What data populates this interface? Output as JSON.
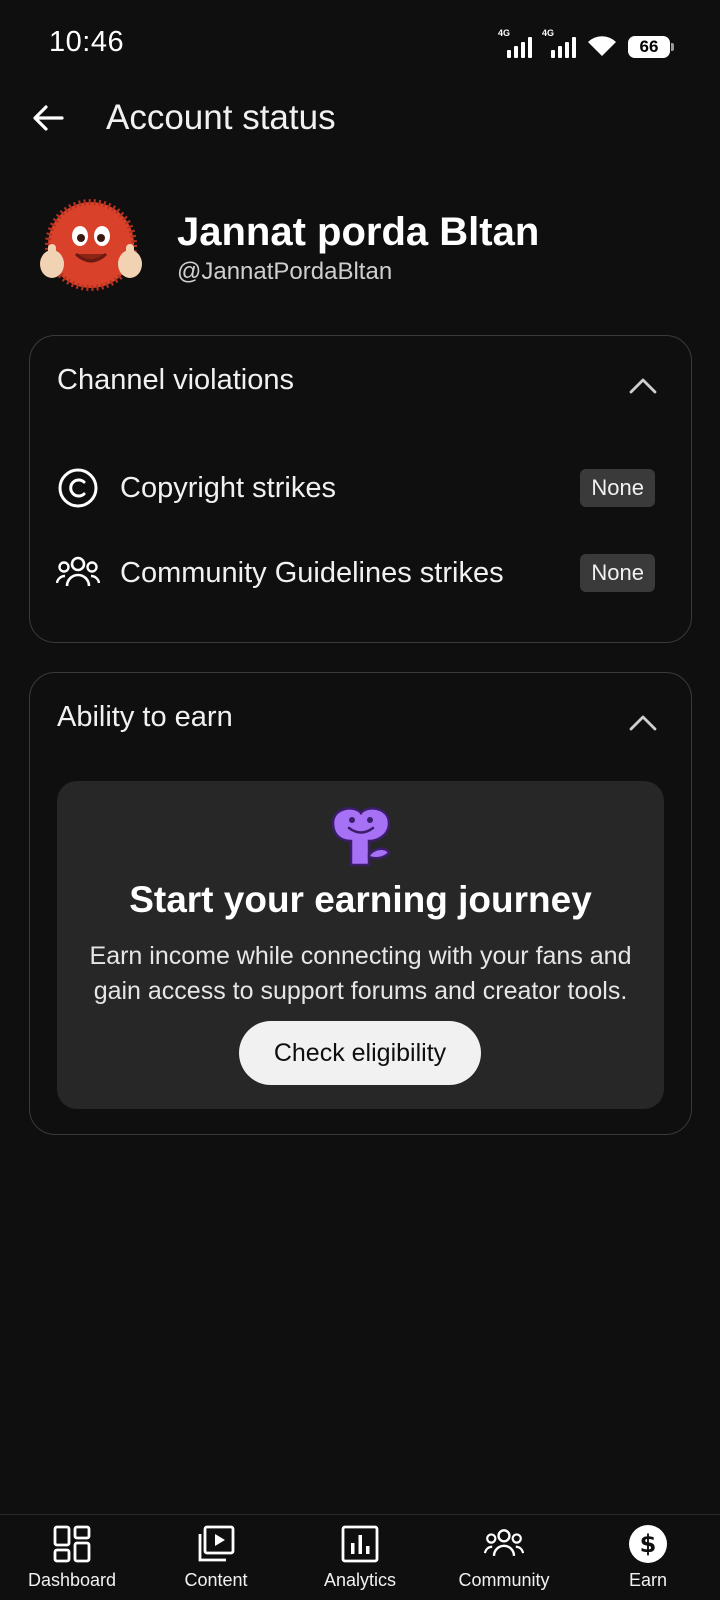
{
  "status_bar": {
    "time": "10:46",
    "network1": "4G",
    "network2": "4G",
    "battery": "66"
  },
  "app_bar": {
    "title": "Account status",
    "back_icon": "arrow-back-icon"
  },
  "profile": {
    "name": "Jannat porda Bltan",
    "handle": "@JannatPordaBltan"
  },
  "channel_violations": {
    "title": "Channel violations",
    "expanded": true,
    "items": [
      {
        "icon": "copyright-icon",
        "label": "Copyright strikes",
        "status": "None"
      },
      {
        "icon": "people-icon",
        "label": "Community Guidelines strikes",
        "status": "None"
      }
    ]
  },
  "ability_to_earn": {
    "title": "Ability to earn",
    "expanded": true,
    "heading": "Start your earning journey",
    "description": "Earn income while connecting with your fans and gain access to support forums and creator tools.",
    "button_label": "Check eligibility",
    "mascot_color": "#a771f5"
  },
  "bottom_nav": {
    "items": [
      {
        "label": "Dashboard",
        "icon": "dashboard-icon"
      },
      {
        "label": "Content",
        "icon": "content-icon"
      },
      {
        "label": "Analytics",
        "icon": "analytics-icon"
      },
      {
        "label": "Community",
        "icon": "community-icon"
      },
      {
        "label": "Earn",
        "icon": "earn-dollar-icon"
      }
    ]
  },
  "colors": {
    "background": "#0f0f0f",
    "card_border": "#3a3a3a",
    "earn_panel": "#272727",
    "badge": "#3a3a3a",
    "text": "#f1f1f1"
  }
}
